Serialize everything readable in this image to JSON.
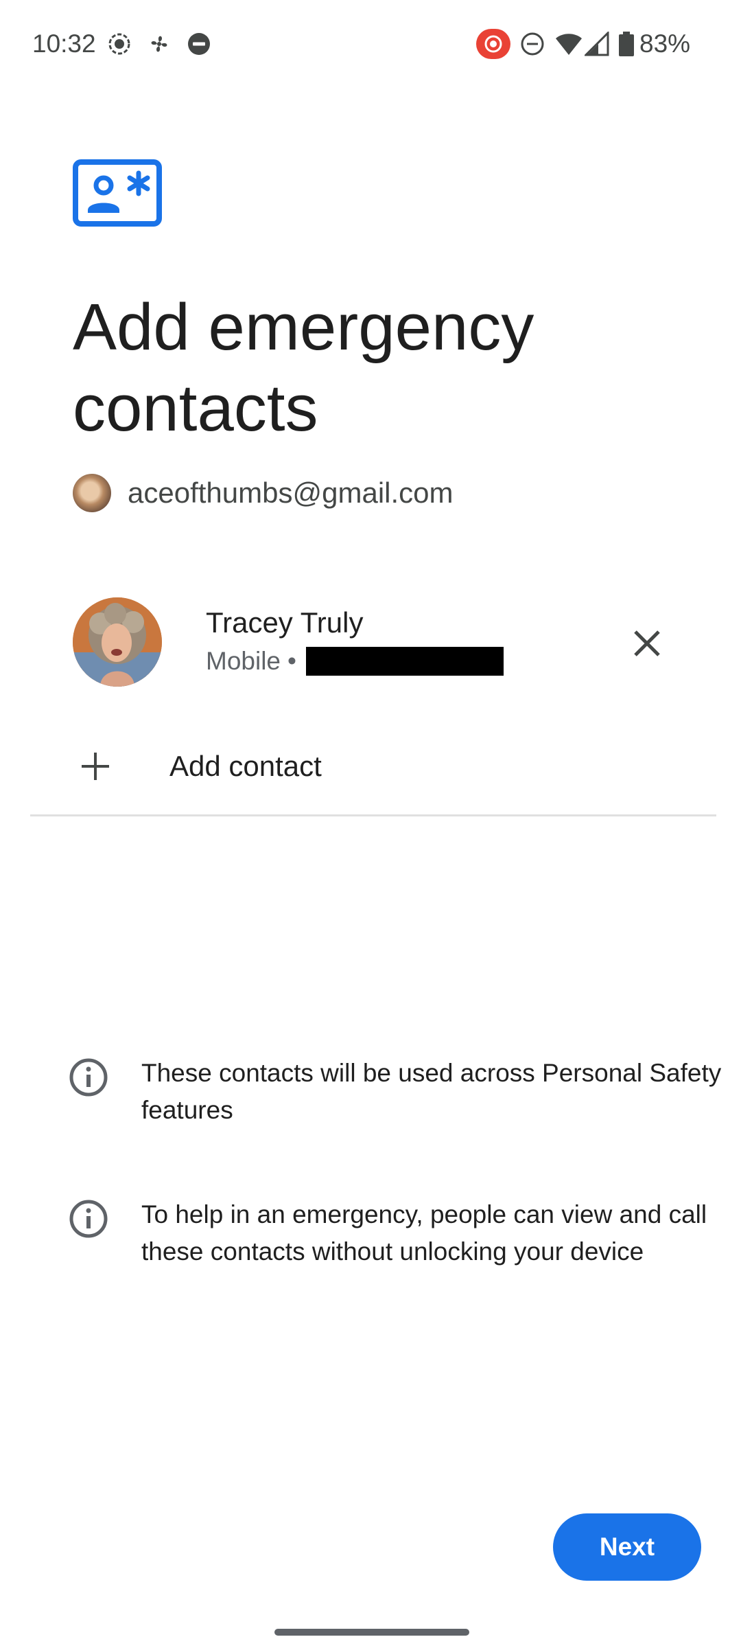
{
  "status_bar": {
    "time": "10:32",
    "battery_percent": "83%",
    "left_icons": [
      "screen-record-icon",
      "fan-icon",
      "dnd-icon"
    ],
    "right_icons": [
      "cast-icon",
      "dnd-icon",
      "wifi-icon",
      "cell-signal-icon",
      "battery-icon"
    ]
  },
  "header": {
    "icon": "contact-card-icon",
    "title": "Add emergency contacts",
    "account_email": "aceofthumbs@gmail.com"
  },
  "contacts": [
    {
      "name": "Tracey Truly",
      "type": "Mobile",
      "separator": "•"
    }
  ],
  "add_contact": {
    "label": "Add contact"
  },
  "info": [
    {
      "icon": "info-icon",
      "text": "These contacts will be used across Personal Safety features"
    },
    {
      "icon": "info-icon",
      "text": "To help in an emergency, people can view and call these contacts without unlocking your device"
    }
  ],
  "actions": {
    "next_label": "Next"
  },
  "colors": {
    "accent": "#1a73e8",
    "text_primary": "#1f1f1f",
    "text_secondary": "#5f6368",
    "status_red": "#e94235"
  }
}
